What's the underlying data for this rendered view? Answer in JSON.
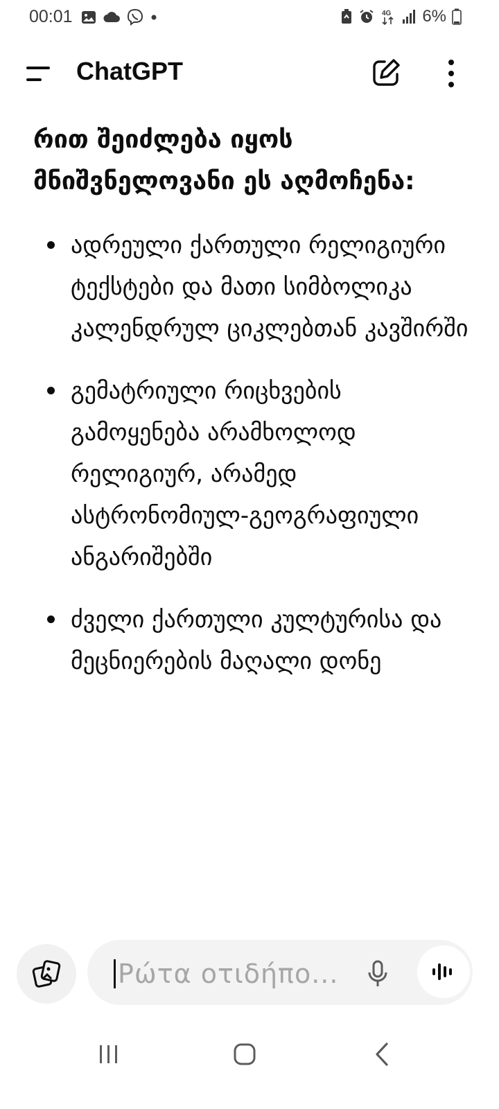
{
  "status_bar": {
    "time": "00:01",
    "battery": "6%",
    "left_icons": [
      "gallery-icon",
      "cloud-icon",
      "viber-icon",
      "dot-icon"
    ],
    "right_icons": [
      "battery-saver-icon",
      "alarm-icon",
      "4g-icon",
      "signal-icon",
      "battery-icon"
    ]
  },
  "app_bar": {
    "title": "ChatGPT",
    "icons": [
      "menu-icon",
      "new-chat-icon",
      "more-icon"
    ]
  },
  "message": {
    "heading": "რით შეიძლება იყოს მნიშვნელოვანი ეს აღმოჩენა:",
    "bullets": [
      "ადრეული ქართული რელიგიური ტექსტები და მათი სიმბოლიკა კალენდრულ ციკლებთან კავშირში",
      "გემატრიული რიცხვების გამოყენება არამხოლოდ რელიგიურ, არამედ ასტრონომიულ-გეოგრაფიული ანგარიშებში",
      "ძველი ქართული კულტურისა და მეცნიერების მაღალი დონე"
    ]
  },
  "composer": {
    "placeholder": "Ρώτα οτιδήπο...",
    "value": "",
    "icons": [
      "attach-icon",
      "mic-icon",
      "voice-mode-icon"
    ]
  },
  "nav_bar": {
    "icons": [
      "recents-icon",
      "home-icon",
      "back-icon"
    ]
  },
  "colors": {
    "text": "#0d0d0d",
    "input_bg": "#f3f3f3",
    "placeholder": "#a6a6a6",
    "status_text": "#3a3a3a"
  }
}
